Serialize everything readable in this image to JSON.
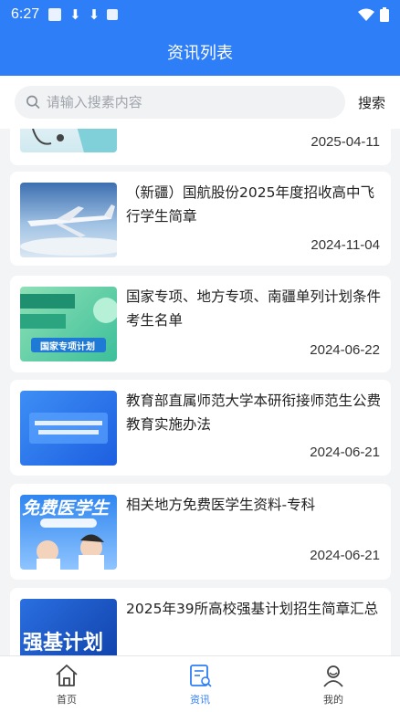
{
  "status_bar": {
    "time": "6:27"
  },
  "header": {
    "title": "资讯列表"
  },
  "search": {
    "placeholder": "请输入搜素内容",
    "button_label": "搜索"
  },
  "articles": [
    {
      "title": "",
      "date": "2025-04-11"
    },
    {
      "title": "（新疆）国航股份2025年度招收高中飞行学生简章",
      "date": "2024-11-04"
    },
    {
      "title": "国家专项、地方专项、南疆单列计划条件考生名单",
      "date": "2024-06-22",
      "thumb_text": "国家专项计划"
    },
    {
      "title": "教育部直属师范大学本研衔接师范生公费教育实施办法",
      "date": "2024-06-21"
    },
    {
      "title": "相关地方免费医学生资料-专科",
      "date": "2024-06-21",
      "thumb_text": "免费医学生"
    },
    {
      "title": "2025年39所高校强基计划招生简章汇总",
      "date": "",
      "thumb_text": "强基计划"
    }
  ],
  "tabs": [
    {
      "label": "首页",
      "icon": "home-icon",
      "active": false
    },
    {
      "label": "资讯",
      "icon": "news-icon",
      "active": true
    },
    {
      "label": "我的",
      "icon": "profile-icon",
      "active": false
    }
  ],
  "colors": {
    "primary": "#2d7ef7",
    "background": "#f3f4f6"
  }
}
